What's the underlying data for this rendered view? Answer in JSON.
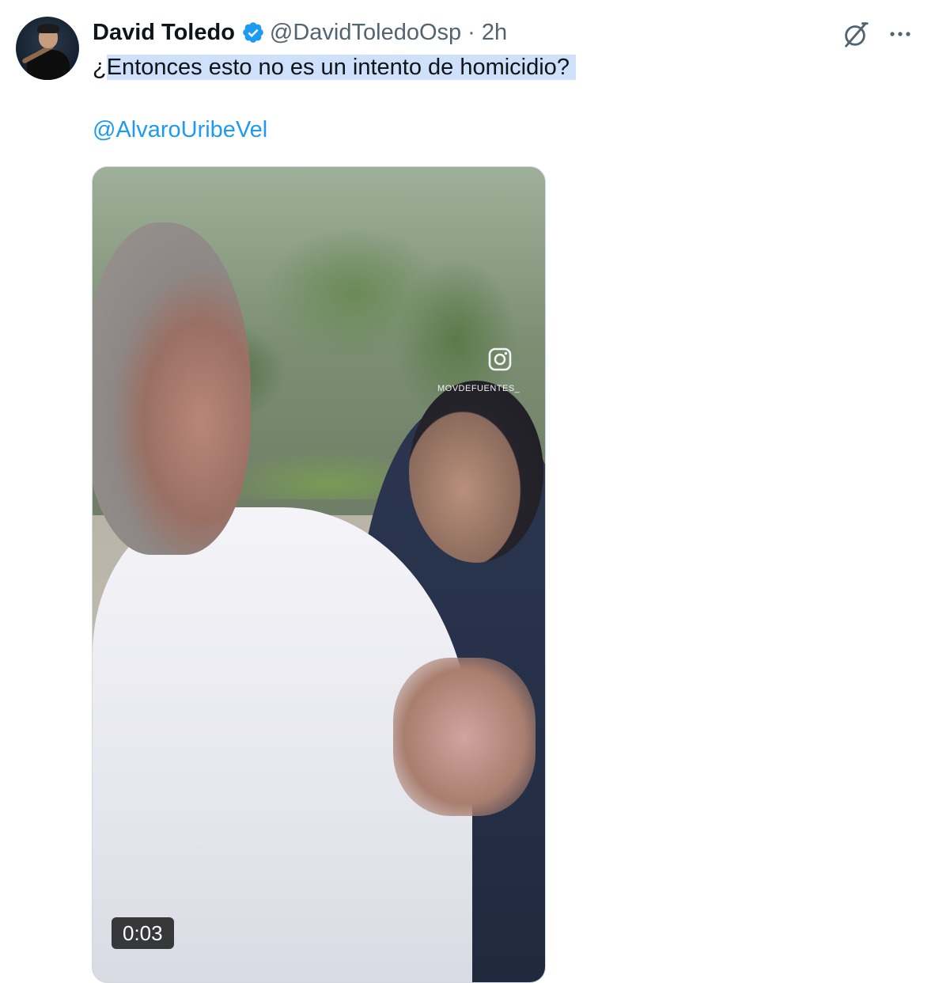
{
  "tweet": {
    "author_name": "David Toledo",
    "handle": "@DavidToledoOsp",
    "separator": "·",
    "time": "2h",
    "text_prefix": "¿",
    "text_selected": "Entonces esto no es un intento de homicidio?",
    "mention": "@AlvaroUribeVel",
    "verified": true
  },
  "media": {
    "type": "video",
    "duration": "0:03",
    "watermark_text": "MOVDEFUENTES_"
  },
  "icons": {
    "verified_badge": "verified-badge-icon",
    "grok": "grok-icon",
    "more": "more-options-icon",
    "instagram": "instagram-icon"
  },
  "colors": {
    "link": "#1d9bf0",
    "secondary_text": "#536471",
    "selection": "#cfe0fa"
  }
}
